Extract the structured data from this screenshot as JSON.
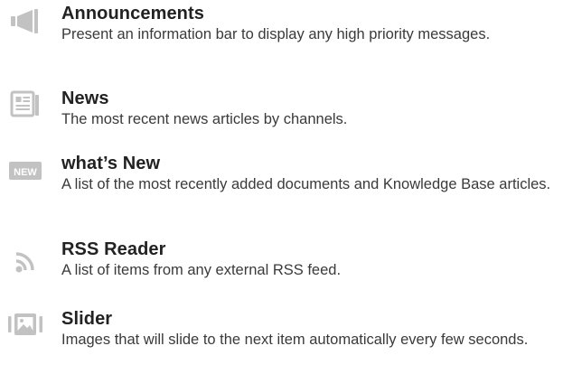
{
  "widgets": [
    {
      "icon": "megaphone-icon",
      "title": "Announcements",
      "description": "Present an information bar to display any high priority messages."
    },
    {
      "icon": "newspaper-icon",
      "title": "News",
      "description": "The most recent news articles by channels."
    },
    {
      "icon": "new-badge-icon",
      "icon_text": "NEW",
      "title": "what’s New",
      "description": "A list of the most recently added documents and Knowledge Base articles."
    },
    {
      "icon": "rss-icon",
      "title": "RSS Reader",
      "description": "A list of items from any external RSS feed."
    },
    {
      "icon": "image-slider-icon",
      "title": "Slider",
      "description": "Images that will slide to the next item automatically every few seconds."
    }
  ],
  "colors": {
    "icon": "#c2c2c2",
    "title": "#222222",
    "description": "#3a3a3a"
  }
}
